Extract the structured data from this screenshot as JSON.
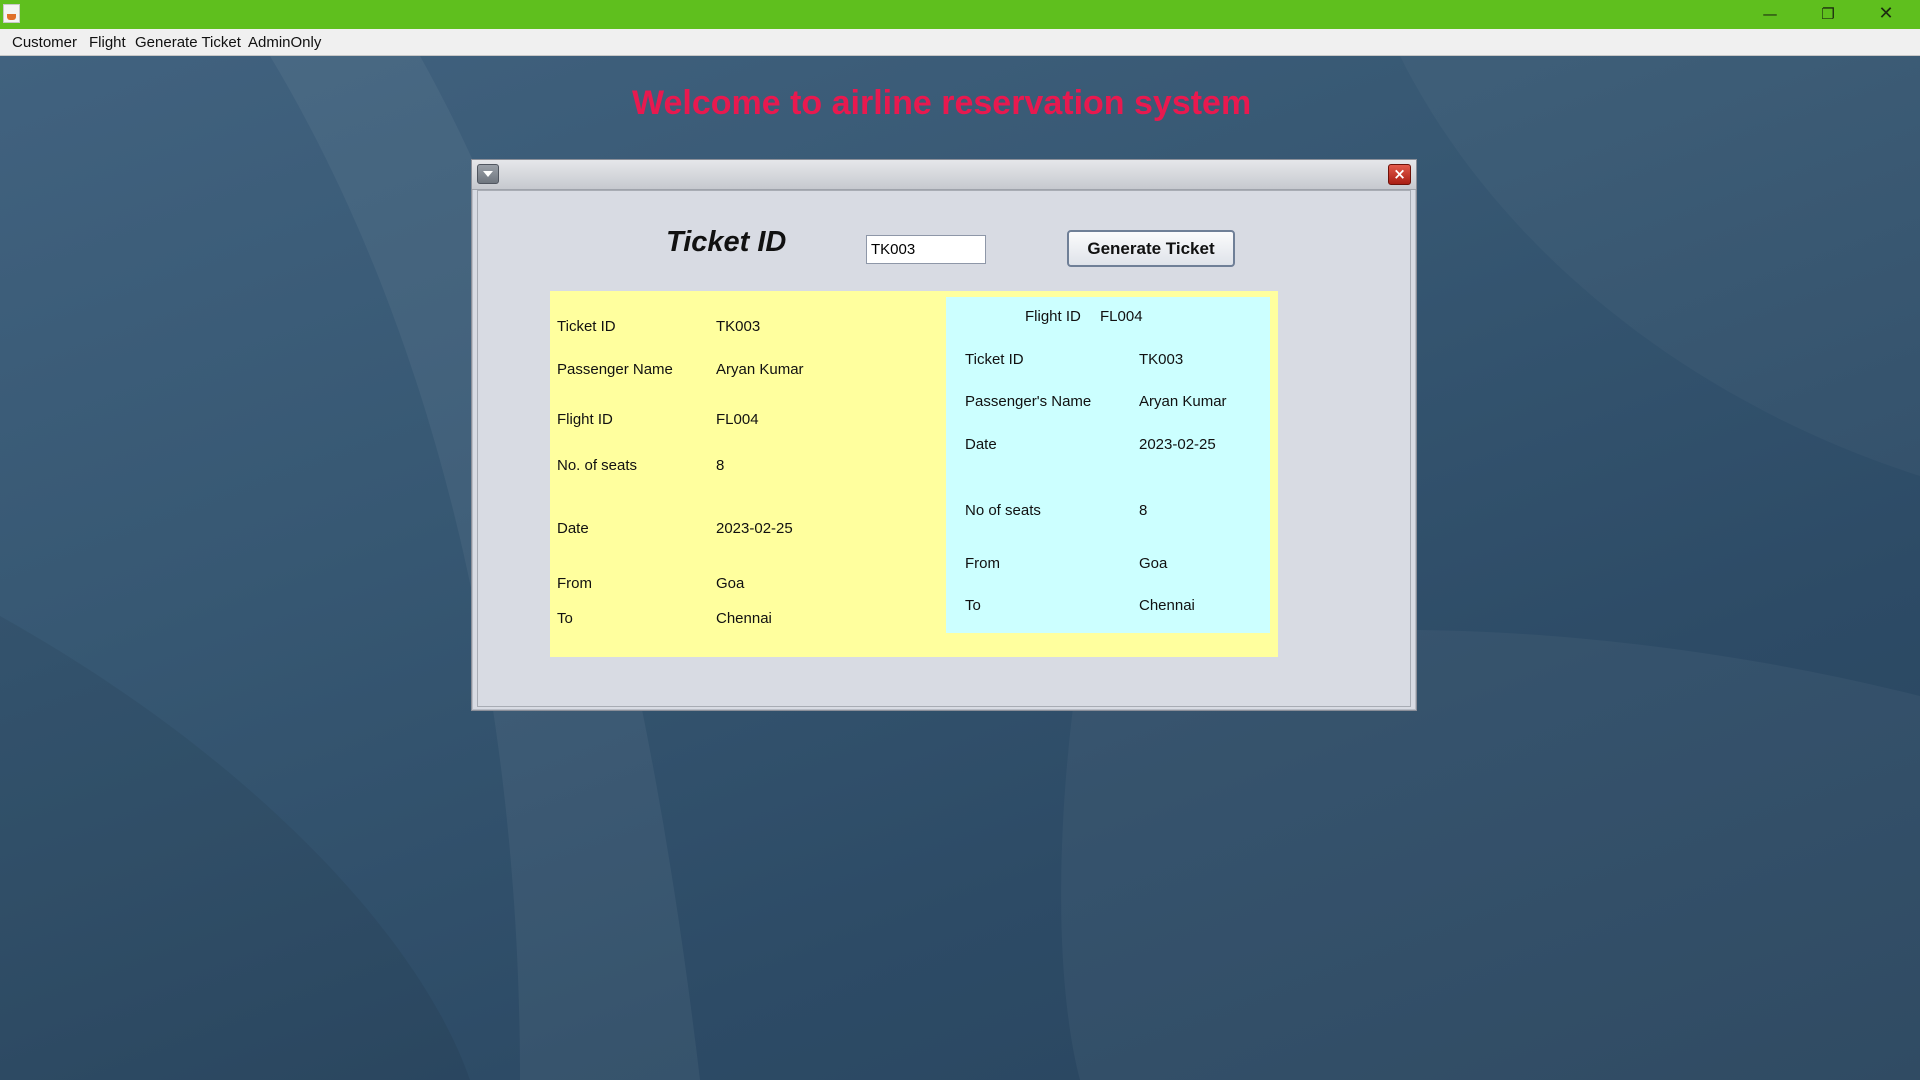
{
  "menu": {
    "items": [
      "Customer",
      "Flight",
      "Generate Ticket",
      "AdminOnly"
    ]
  },
  "window": {
    "minimize_glyph": "—",
    "maximize_glyph": "❐",
    "close_glyph": "✕"
  },
  "welcome": "Welcome to airline reservation system",
  "form": {
    "ticket_id_label": "Ticket ID",
    "ticket_id_value": "TK003",
    "generate_label": "Generate Ticket"
  },
  "ticket": {
    "ticket_id_label": "Ticket ID",
    "ticket_id": "TK003",
    "passenger_label": "Passenger Name",
    "passenger": "Aryan Kumar",
    "flight_id_label": "Flight ID",
    "flight_id": "FL004",
    "seats_label": "No. of seats",
    "seats": "8",
    "date_label": "Date",
    "date": "2023-02-25",
    "from_label": "From",
    "from": "Goa",
    "to_label": "To",
    "to": "Chennai"
  },
  "stub": {
    "flight_id_label": "Flight ID",
    "flight_id": "FL004",
    "ticket_id_label": "Ticket ID",
    "ticket_id": "TK003",
    "passenger_label": "Passenger's Name",
    "passenger": "Aryan Kumar",
    "date_label": "Date",
    "date": "2023-02-25",
    "seats_label": "No of seats",
    "seats": "8",
    "from_label": "From",
    "from": "Goa",
    "to_label": "To",
    "to": "Chennai"
  },
  "colors": {
    "titlebar": "#5fbf1e",
    "welcome": "#e8194f",
    "ticket_panel": "#ffff9e",
    "stub_panel": "#ccffff"
  },
  "icons": {
    "app": "java-app-icon",
    "frame_menu": "chevron-down-icon",
    "frame_close": "close-icon"
  }
}
